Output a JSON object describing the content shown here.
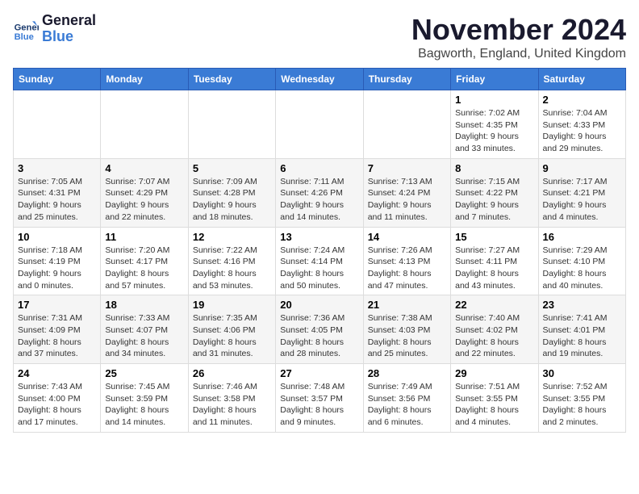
{
  "header": {
    "logo_line1": "General",
    "logo_line2": "Blue",
    "month": "November 2024",
    "location": "Bagworth, England, United Kingdom"
  },
  "weekdays": [
    "Sunday",
    "Monday",
    "Tuesday",
    "Wednesday",
    "Thursday",
    "Friday",
    "Saturday"
  ],
  "weeks": [
    [
      {
        "day": "",
        "info": ""
      },
      {
        "day": "",
        "info": ""
      },
      {
        "day": "",
        "info": ""
      },
      {
        "day": "",
        "info": ""
      },
      {
        "day": "",
        "info": ""
      },
      {
        "day": "1",
        "info": "Sunrise: 7:02 AM\nSunset: 4:35 PM\nDaylight: 9 hours and 33 minutes."
      },
      {
        "day": "2",
        "info": "Sunrise: 7:04 AM\nSunset: 4:33 PM\nDaylight: 9 hours and 29 minutes."
      }
    ],
    [
      {
        "day": "3",
        "info": "Sunrise: 7:05 AM\nSunset: 4:31 PM\nDaylight: 9 hours and 25 minutes."
      },
      {
        "day": "4",
        "info": "Sunrise: 7:07 AM\nSunset: 4:29 PM\nDaylight: 9 hours and 22 minutes."
      },
      {
        "day": "5",
        "info": "Sunrise: 7:09 AM\nSunset: 4:28 PM\nDaylight: 9 hours and 18 minutes."
      },
      {
        "day": "6",
        "info": "Sunrise: 7:11 AM\nSunset: 4:26 PM\nDaylight: 9 hours and 14 minutes."
      },
      {
        "day": "7",
        "info": "Sunrise: 7:13 AM\nSunset: 4:24 PM\nDaylight: 9 hours and 11 minutes."
      },
      {
        "day": "8",
        "info": "Sunrise: 7:15 AM\nSunset: 4:22 PM\nDaylight: 9 hours and 7 minutes."
      },
      {
        "day": "9",
        "info": "Sunrise: 7:17 AM\nSunset: 4:21 PM\nDaylight: 9 hours and 4 minutes."
      }
    ],
    [
      {
        "day": "10",
        "info": "Sunrise: 7:18 AM\nSunset: 4:19 PM\nDaylight: 9 hours and 0 minutes."
      },
      {
        "day": "11",
        "info": "Sunrise: 7:20 AM\nSunset: 4:17 PM\nDaylight: 8 hours and 57 minutes."
      },
      {
        "day": "12",
        "info": "Sunrise: 7:22 AM\nSunset: 4:16 PM\nDaylight: 8 hours and 53 minutes."
      },
      {
        "day": "13",
        "info": "Sunrise: 7:24 AM\nSunset: 4:14 PM\nDaylight: 8 hours and 50 minutes."
      },
      {
        "day": "14",
        "info": "Sunrise: 7:26 AM\nSunset: 4:13 PM\nDaylight: 8 hours and 47 minutes."
      },
      {
        "day": "15",
        "info": "Sunrise: 7:27 AM\nSunset: 4:11 PM\nDaylight: 8 hours and 43 minutes."
      },
      {
        "day": "16",
        "info": "Sunrise: 7:29 AM\nSunset: 4:10 PM\nDaylight: 8 hours and 40 minutes."
      }
    ],
    [
      {
        "day": "17",
        "info": "Sunrise: 7:31 AM\nSunset: 4:09 PM\nDaylight: 8 hours and 37 minutes."
      },
      {
        "day": "18",
        "info": "Sunrise: 7:33 AM\nSunset: 4:07 PM\nDaylight: 8 hours and 34 minutes."
      },
      {
        "day": "19",
        "info": "Sunrise: 7:35 AM\nSunset: 4:06 PM\nDaylight: 8 hours and 31 minutes."
      },
      {
        "day": "20",
        "info": "Sunrise: 7:36 AM\nSunset: 4:05 PM\nDaylight: 8 hours and 28 minutes."
      },
      {
        "day": "21",
        "info": "Sunrise: 7:38 AM\nSunset: 4:03 PM\nDaylight: 8 hours and 25 minutes."
      },
      {
        "day": "22",
        "info": "Sunrise: 7:40 AM\nSunset: 4:02 PM\nDaylight: 8 hours and 22 minutes."
      },
      {
        "day": "23",
        "info": "Sunrise: 7:41 AM\nSunset: 4:01 PM\nDaylight: 8 hours and 19 minutes."
      }
    ],
    [
      {
        "day": "24",
        "info": "Sunrise: 7:43 AM\nSunset: 4:00 PM\nDaylight: 8 hours and 17 minutes."
      },
      {
        "day": "25",
        "info": "Sunrise: 7:45 AM\nSunset: 3:59 PM\nDaylight: 8 hours and 14 minutes."
      },
      {
        "day": "26",
        "info": "Sunrise: 7:46 AM\nSunset: 3:58 PM\nDaylight: 8 hours and 11 minutes."
      },
      {
        "day": "27",
        "info": "Sunrise: 7:48 AM\nSunset: 3:57 PM\nDaylight: 8 hours and 9 minutes."
      },
      {
        "day": "28",
        "info": "Sunrise: 7:49 AM\nSunset: 3:56 PM\nDaylight: 8 hours and 6 minutes."
      },
      {
        "day": "29",
        "info": "Sunrise: 7:51 AM\nSunset: 3:55 PM\nDaylight: 8 hours and 4 minutes."
      },
      {
        "day": "30",
        "info": "Sunrise: 7:52 AM\nSunset: 3:55 PM\nDaylight: 8 hours and 2 minutes."
      }
    ]
  ]
}
